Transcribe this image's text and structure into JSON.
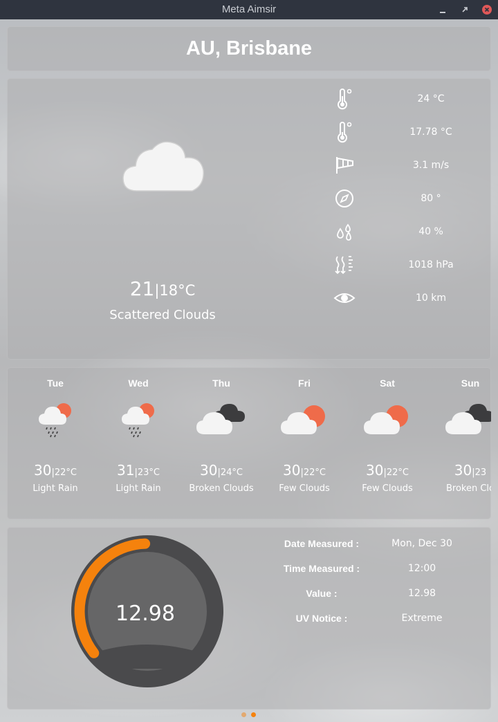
{
  "window": {
    "title": "Meta Aimsir"
  },
  "location": "AU, Brisbane",
  "current": {
    "icon": "scattered-clouds-icon",
    "temp_max": "21",
    "separator": "|",
    "temp_min": "18°C",
    "description": "Scattered Clouds",
    "stats": [
      {
        "icon": "thermometer-icon",
        "value": "24 °C"
      },
      {
        "icon": "feels-like-thermometer-icon",
        "value": "17.78 °C"
      },
      {
        "icon": "windsock-icon",
        "value": "3.1 m/s"
      },
      {
        "icon": "compass-icon",
        "value": "80 °"
      },
      {
        "icon": "humidity-drops-icon",
        "value": "40 %"
      },
      {
        "icon": "pressure-icon",
        "value": "1018 hPa"
      },
      {
        "icon": "visibility-eye-icon",
        "value": "10 km"
      }
    ]
  },
  "forecast": [
    {
      "day": "Tue",
      "hi": "30",
      "lo": "22°C",
      "desc": "Light Rain",
      "icon": "light-rain-icon"
    },
    {
      "day": "Wed",
      "hi": "31",
      "lo": "23°C",
      "desc": "Light Rain",
      "icon": "light-rain-icon"
    },
    {
      "day": "Thu",
      "hi": "30",
      "lo": "24°C",
      "desc": "Broken Clouds",
      "icon": "broken-clouds-icon"
    },
    {
      "day": "Fri",
      "hi": "30",
      "lo": "22°C",
      "desc": "Few Clouds",
      "icon": "few-clouds-icon"
    },
    {
      "day": "Sat",
      "hi": "30",
      "lo": "22°C",
      "desc": "Few Clouds",
      "icon": "few-clouds-icon"
    },
    {
      "day": "Sun",
      "hi": "30",
      "lo": "23",
      "desc": "Broken Clo",
      "icon": "broken-clouds-icon"
    }
  ],
  "uv": {
    "gauge_value": "12.98",
    "gauge_fraction": 0.35,
    "rows": [
      {
        "label": "Date Measured :",
        "value": "Mon, Dec 30"
      },
      {
        "label": "Time Measured :",
        "value": "12:00"
      },
      {
        "label": "Value :",
        "value": "12.98"
      },
      {
        "label": "UV Notice :",
        "value": "Extreme"
      }
    ]
  },
  "pager": {
    "pages": 2,
    "active": 1
  },
  "colors": {
    "accent": "#f5820d",
    "sun": "#ef6b4a",
    "gauge_track": "#4a4a4c",
    "gauge_inner": "#666667",
    "titlebar": "#2f343f",
    "close": "#e05858"
  }
}
